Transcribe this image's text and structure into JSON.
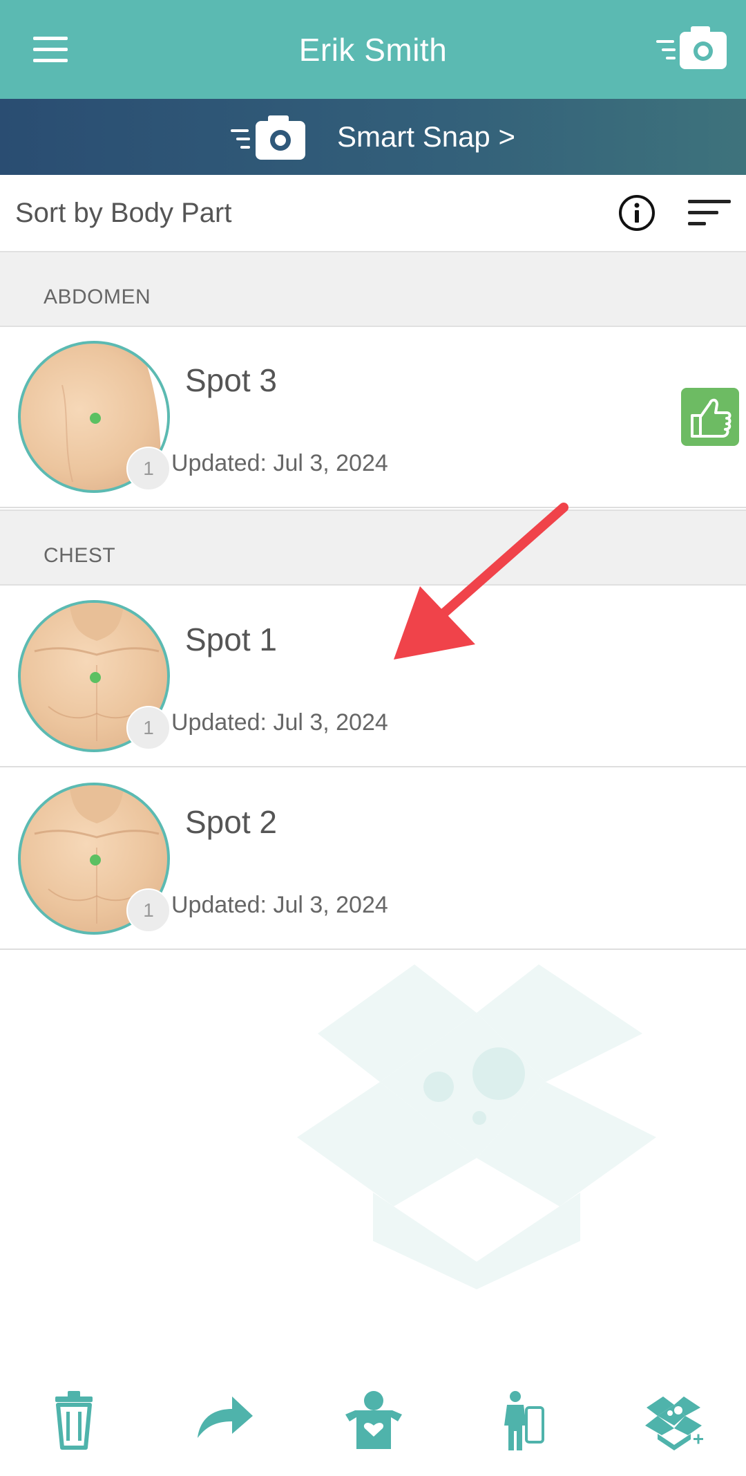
{
  "header": {
    "title": "Erik Smith",
    "menu_icon": "hamburger-menu-icon",
    "camera_icon": "quick-camera-icon"
  },
  "smart_snap": {
    "label": "Smart Snap >",
    "icon": "quick-camera-icon"
  },
  "sortbar": {
    "label": "Sort by Body Part",
    "info_icon": "info-icon",
    "sort_icon": "sort-icon"
  },
  "sections": [
    {
      "label": "ABDOMEN",
      "spots": [
        {
          "name": "Spot 3",
          "updated": "Updated: Jul 3, 2024",
          "count": "1",
          "badge": "thumbs-up-icon"
        }
      ]
    },
    {
      "label": "CHEST",
      "spots": [
        {
          "name": "Spot 1",
          "updated": "Updated: Jul 3, 2024",
          "count": "1"
        },
        {
          "name": "Spot 2",
          "updated": "Updated: Jul 3, 2024",
          "count": "1"
        }
      ]
    }
  ],
  "bottombar": {
    "icons": [
      "trash-icon",
      "share-icon",
      "patient-care-icon",
      "body-map-icon",
      "add-box-icon"
    ]
  },
  "colors": {
    "teal": "#5bbab2",
    "navy": "#2a4d72",
    "green": "#6dbb63",
    "arrow": "#f0434a"
  }
}
